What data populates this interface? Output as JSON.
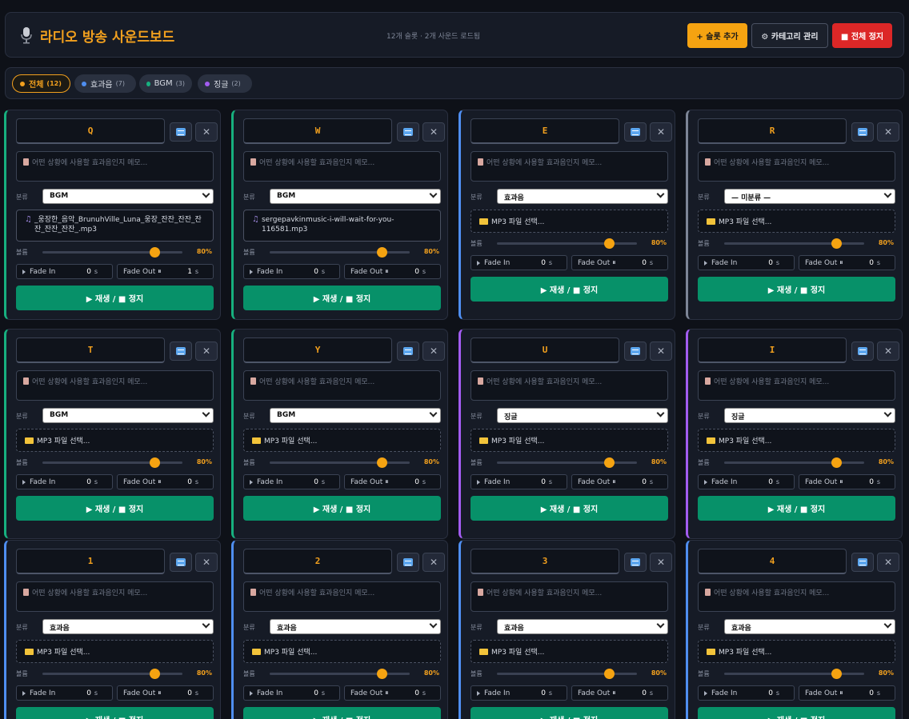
{
  "header": {
    "title": "라디오 방송 사운드보드",
    "subtitle": "12개 슬롯 · 2개 사운드 로드됨",
    "add_slot": "+ 슬롯 추가",
    "manage_categories": "⚙ 카테고리 관리",
    "stop_all": "■ 전체 정지"
  },
  "filters": [
    {
      "label": "전체",
      "count": "(12)",
      "color": "#f2a01e",
      "active": true
    },
    {
      "label": "효과음",
      "count": "(7)",
      "color": "#4f8ef0",
      "active": false
    },
    {
      "label": "BGM",
      "count": "(3)",
      "color": "#17b07f",
      "active": false
    },
    {
      "label": "징글",
      "count": "(2)",
      "color": "#a25cf0",
      "active": false
    }
  ],
  "labels": {
    "memo_placeholder": "어떤 상황에 사용할 효과음인지 메모...",
    "category": "분류",
    "volume": "볼륨",
    "fade_in": "Fade In",
    "fade_out": "Fade Out ⏸",
    "sec": "s",
    "file_placeholder": "MP3 파일 선택...",
    "play": "▶ 재생 / ■ 정지"
  },
  "colors": {
    "BGM": "#17b07f",
    "효과음": "#4f8ef0",
    "징글": "#a25cf0",
    "uncategorized": "#7d8596"
  },
  "slots": [
    {
      "key": "Q",
      "category": "BGM",
      "file": "_웅장한_음악_BrunuhVille_Luna_웅장_잔잔_잔잔_잔잔_잔잔_잔잔_.mp3",
      "volume": 80,
      "volume_label": "80%",
      "fade_in": "0",
      "fade_out": "1"
    },
    {
      "key": "W",
      "category": "BGM",
      "file": "sergepavkinmusic-i-will-wait-for-you-116581.mp3",
      "volume": 80,
      "volume_label": "80%",
      "fade_in": "0",
      "fade_out": "0"
    },
    {
      "key": "E",
      "category": "효과음",
      "file": "",
      "volume": 80,
      "volume_label": "80%",
      "fade_in": "0",
      "fade_out": "0"
    },
    {
      "key": "R",
      "category": "— 미분류 —",
      "file": "",
      "volume": 80,
      "volume_label": "80%",
      "fade_in": "0",
      "fade_out": "0"
    },
    {
      "key": "T",
      "category": "BGM",
      "file": "",
      "volume": 80,
      "volume_label": "80%",
      "fade_in": "0",
      "fade_out": "0"
    },
    {
      "key": "Y",
      "category": "BGM",
      "file": "",
      "volume": 80,
      "volume_label": "80%",
      "fade_in": "0",
      "fade_out": "0"
    },
    {
      "key": "U",
      "category": "징글",
      "file": "",
      "volume": 80,
      "volume_label": "80%",
      "fade_in": "0",
      "fade_out": "0"
    },
    {
      "key": "I",
      "category": "징글",
      "file": "",
      "volume": 80,
      "volume_label": "80%",
      "fade_in": "0",
      "fade_out": "0"
    },
    {
      "key": "1",
      "category": "효과음",
      "file": "",
      "volume": 80,
      "volume_label": "80%",
      "fade_in": "0",
      "fade_out": "0"
    },
    {
      "key": "2",
      "category": "효과음",
      "file": "",
      "volume": 80,
      "volume_label": "80%",
      "fade_in": "0",
      "fade_out": "0"
    },
    {
      "key": "3",
      "category": "효과음",
      "file": "",
      "volume": 80,
      "volume_label": "80%",
      "fade_in": "0",
      "fade_out": "0"
    },
    {
      "key": "4",
      "category": "효과음",
      "file": "",
      "volume": 80,
      "volume_label": "80%",
      "fade_in": "0",
      "fade_out": "0"
    }
  ]
}
